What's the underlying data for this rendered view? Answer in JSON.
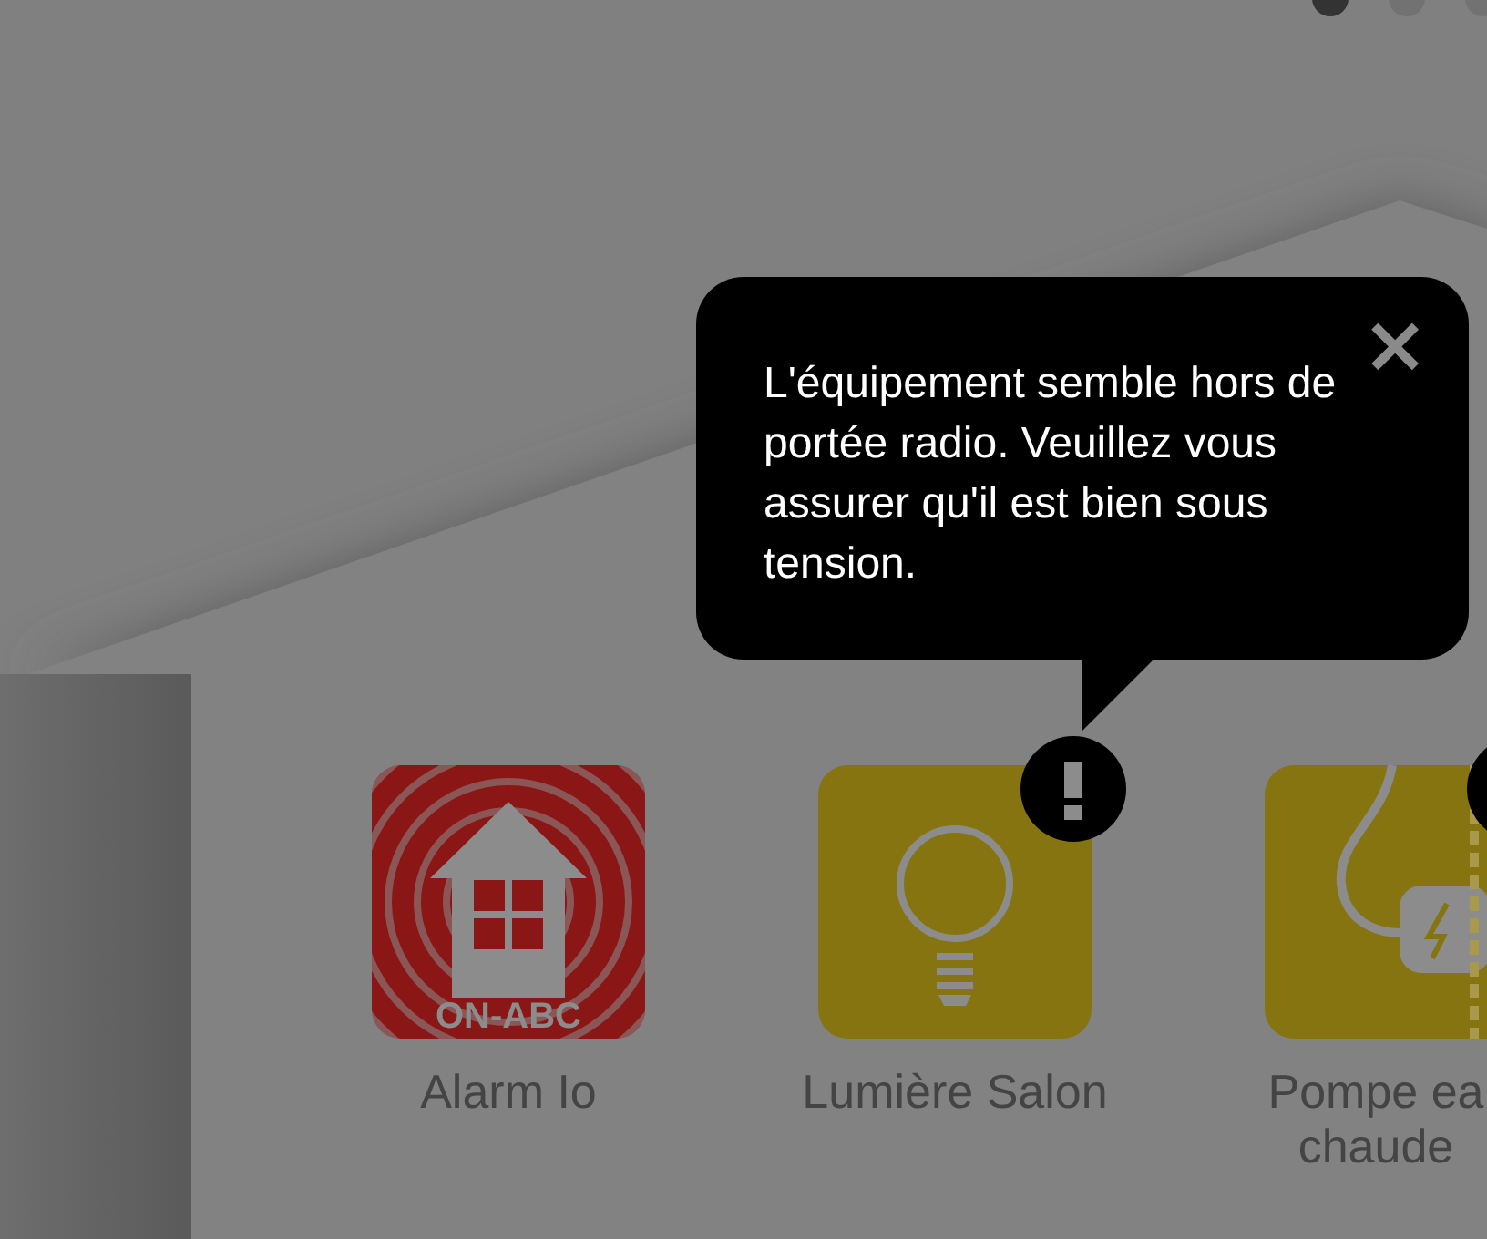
{
  "page_dots": [
    {
      "selected": true
    },
    {
      "selected": false
    },
    {
      "selected": false
    }
  ],
  "devices": [
    {
      "name": "Alarm Io",
      "kind": "alarm",
      "badge_text": "ON-ABC",
      "alert": false
    },
    {
      "name": "Lumière Salon",
      "kind": "light",
      "alert": true
    },
    {
      "name": "Pompe ea chaude",
      "kind": "pump",
      "alert": true
    }
  ],
  "tooltip": {
    "text": "L'équipement semble hors de portée radio. Veuillez vous assurer qu'il est bien sous tension.",
    "close": "×"
  }
}
